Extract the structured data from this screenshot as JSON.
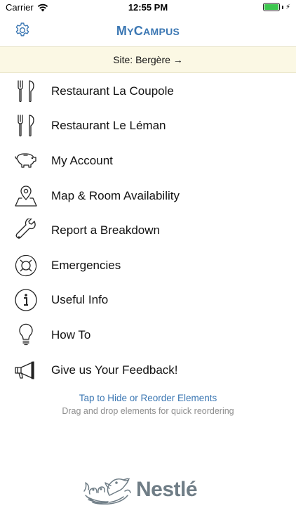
{
  "status_bar": {
    "carrier": "Carrier",
    "time": "12:55 PM",
    "battery_level": 1.0
  },
  "nav": {
    "title_first": "M",
    "title_first_small": "Y",
    "title_second": "C",
    "title_second_small": "AMPUS",
    "settings_icon": "gear-icon"
  },
  "site_banner": {
    "label": "Site: Bergère →"
  },
  "menu": {
    "items": [
      {
        "label": "Restaurant La Coupole",
        "icon": "fork-knife-icon"
      },
      {
        "label": "Restaurant Le Léman",
        "icon": "fork-knife-icon"
      },
      {
        "label": "My Account",
        "icon": "piggy-bank-icon"
      },
      {
        "label": "Map & Room Availability",
        "icon": "map-pin-icon"
      },
      {
        "label": "Report a Breakdown",
        "icon": "wrench-icon"
      },
      {
        "label": "Emergencies",
        "icon": "lifebuoy-icon"
      },
      {
        "label": "Useful Info",
        "icon": "info-icon"
      },
      {
        "label": "How To",
        "icon": "lightbulb-icon"
      },
      {
        "label": "Give us Your Feedback!",
        "icon": "megaphone-icon"
      }
    ]
  },
  "footer": {
    "reorder_link": "Tap to Hide or Reorder Elements",
    "reorder_hint": "Drag and drop elements for quick reordering"
  },
  "logo": {
    "wordmark": "Nestlé"
  },
  "colors": {
    "accent": "#3b77b3",
    "banner_bg": "#fbf8e4",
    "hint": "#8e8e8e",
    "logo_grey": "#6f7d86"
  }
}
